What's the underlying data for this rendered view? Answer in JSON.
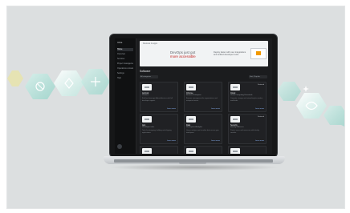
{
  "app": {
    "brand": "Ultra"
  },
  "sidebar": {
    "items": [
      {
        "label": "Home"
      },
      {
        "label": "Overview"
      },
      {
        "label": "Services"
      },
      {
        "label": "Project management"
      },
      {
        "label": "Operations console"
      },
      {
        "label": "Settings"
      },
      {
        "label": "Help"
      }
    ]
  },
  "banner": {
    "crumb": "Devices & apps",
    "line1": "DevOps just got",
    "line2": "more accessible",
    "text": "Deploy faster with new integrations and unified developer tools."
  },
  "section": {
    "title": "Software",
    "filters": [
      "All categories",
      "Sort: Popular"
    ]
  },
  "cards": [
    {
      "title": "Android",
      "sub": "Platform",
      "desc": "Build and manage Android devices with full developer support.",
      "link": "Learn more",
      "badge": ""
    },
    {
      "title": "Chrome",
      "sub": "Browser Enterprise",
      "desc": "Browser management for organizations and enterprise teams.",
      "link": "Learn more",
      "badge": ""
    },
    {
      "title": "Cloud",
      "sub": "Cloud Computing Essentials",
      "desc": "Compute, storage and networking for modern workloads.",
      "link": "Learn more",
      "badge": "Featured"
    },
    {
      "title": "App",
      "sub": "Developer tools",
      "desc": "Tools for designing, building and shipping applications.",
      "link": "Learn more",
      "badge": ""
    },
    {
      "title": "Data",
      "sub": "Workspace Analytics",
      "desc": "Query, analyze and visualize data across your workspace.",
      "link": "Learn more",
      "badge": ""
    },
    {
      "title": "Security",
      "sub": "Identity & Access",
      "desc": "Protect users and resources with identity controls.",
      "link": "Learn more",
      "badge": "Featured"
    }
  ],
  "colors": {
    "background": "#dcdfe0",
    "screen": "#1b1c1e",
    "accent_red": "#c5221f",
    "hex_tint": "#9fd8cf"
  },
  "icons": [
    "hexagon-node-icon",
    "sparkle-icon"
  ]
}
